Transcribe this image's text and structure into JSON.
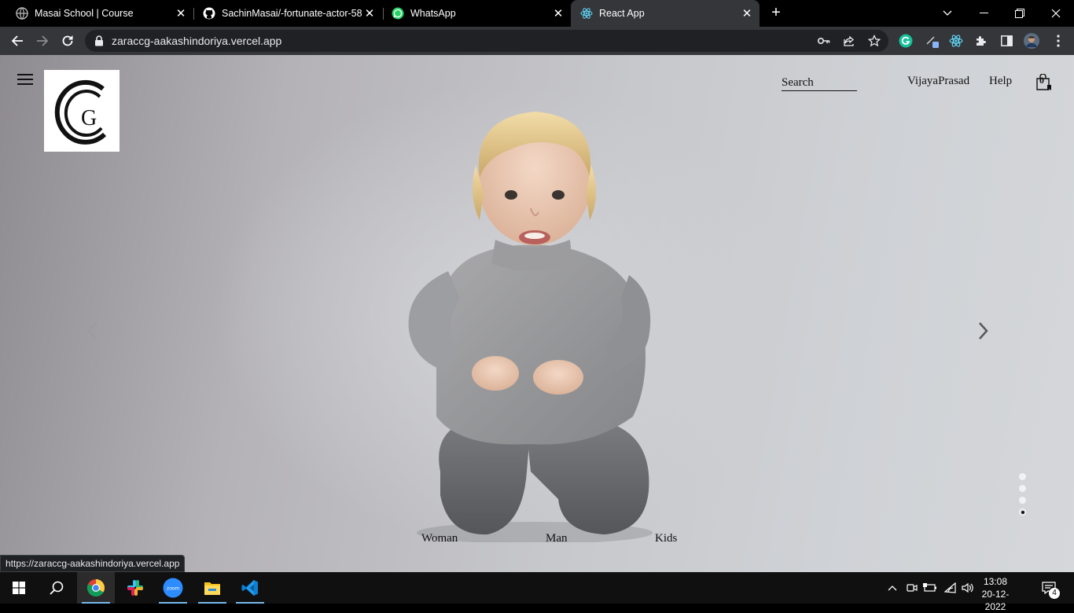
{
  "browser": {
    "tabs": [
      {
        "title": "Masai School | Course",
        "icon": "globe-icon",
        "active": false
      },
      {
        "title": "SachinMasai/-fortunate-actor-58",
        "icon": "github-icon",
        "active": false
      },
      {
        "title": "WhatsApp",
        "icon": "whatsapp-icon",
        "active": false
      },
      {
        "title": "React App",
        "icon": "react-icon",
        "active": true
      }
    ],
    "url": "zaraccg-aakashindoriya.vercel.app",
    "status_url": "https://zaraccg-aakashindoriya.vercel.app"
  },
  "site": {
    "logo_letters": "CCG",
    "header": {
      "search_label": "Search",
      "user_label": "VijayaPrasad",
      "help_label": "Help",
      "bag_count": "0"
    },
    "categories": [
      "Woman",
      "Man",
      "Kids"
    ],
    "carousel": {
      "slides": 4,
      "active_index": 3
    }
  },
  "taskbar": {
    "apps": [
      "windows-start-icon",
      "search-icon",
      "chrome-icon",
      "slack-icon",
      "zoom-icon",
      "file-explorer-icon",
      "vscode-icon"
    ],
    "zoom_label": "zoom",
    "time": "13:08",
    "date": "20-12-2022",
    "notifications": "4"
  },
  "colors": {
    "chrome_dark": "#35363a",
    "tab_bar": "#000000",
    "taskbar": "#101010",
    "accent_blue": "#76b9ed"
  }
}
